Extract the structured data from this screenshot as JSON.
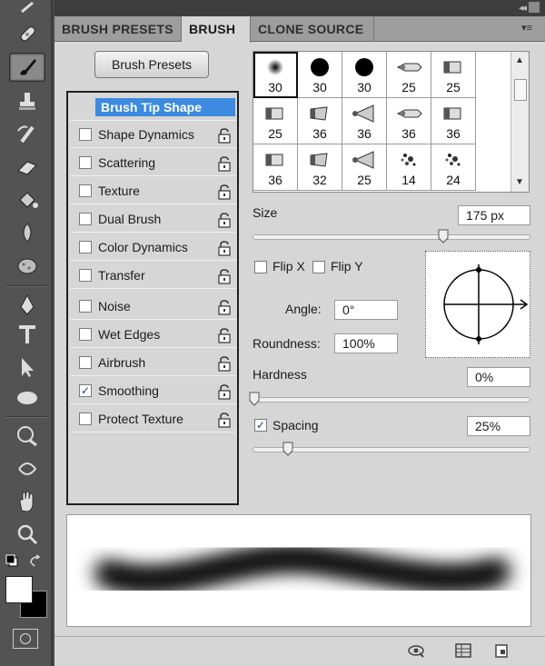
{
  "tabs": [
    "BRUSH PRESETS",
    "BRUSH",
    "CLONE SOURCE"
  ],
  "active_tab": "BRUSH",
  "brush_presets_button": "Brush Presets",
  "options": [
    {
      "label": "Brush Tip Shape",
      "header": true
    },
    {
      "label": "Shape Dynamics",
      "checked": false
    },
    {
      "label": "Scattering",
      "checked": false
    },
    {
      "label": "Texture",
      "checked": false
    },
    {
      "label": "Dual Brush",
      "checked": false
    },
    {
      "label": "Color Dynamics",
      "checked": false
    },
    {
      "label": "Transfer",
      "checked": false
    },
    {
      "label": "Noise",
      "checked": false
    },
    {
      "label": "Wet Edges",
      "checked": false
    },
    {
      "label": "Airbrush",
      "checked": false
    },
    {
      "label": "Smoothing",
      "checked": true
    },
    {
      "label": "Protect Texture",
      "checked": false
    }
  ],
  "brush_tips": [
    {
      "size": "30",
      "shape": "soft-round",
      "selected": true
    },
    {
      "size": "30",
      "shape": "hard-round"
    },
    {
      "size": "30",
      "shape": "hard-round"
    },
    {
      "size": "25",
      "shape": "pen"
    },
    {
      "size": "25",
      "shape": "flat"
    },
    {
      "size": "25",
      "shape": "flat"
    },
    {
      "size": "36",
      "shape": "angled"
    },
    {
      "size": "36",
      "shape": "fan"
    },
    {
      "size": "36",
      "shape": "pen"
    },
    {
      "size": "36",
      "shape": "flat"
    },
    {
      "size": "36",
      "shape": "flat"
    },
    {
      "size": "32",
      "shape": "angled"
    },
    {
      "size": "25",
      "shape": "fan"
    },
    {
      "size": "14",
      "shape": "scatter"
    },
    {
      "size": "24",
      "shape": "scatter"
    }
  ],
  "size": {
    "label": "Size",
    "value": "175 px"
  },
  "flip_x": {
    "label": "Flip X",
    "checked": false
  },
  "flip_y": {
    "label": "Flip Y",
    "checked": false
  },
  "angle": {
    "label": "Angle:",
    "value": "0°"
  },
  "roundness": {
    "label": "Roundness:",
    "value": "100%"
  },
  "hardness": {
    "label": "Hardness",
    "value": "0%"
  },
  "spacing": {
    "label": "Spacing",
    "value": "25%",
    "checked": true
  },
  "colors": {
    "accent": "#3c8ae0",
    "panel": "#d6d6d6",
    "toolbar": "#535353"
  },
  "icons": [
    "brush-icon",
    "stamp-icon",
    "eraser-icon",
    "pen-icon",
    "type-icon",
    "zoom-icon",
    "hand-icon"
  ]
}
